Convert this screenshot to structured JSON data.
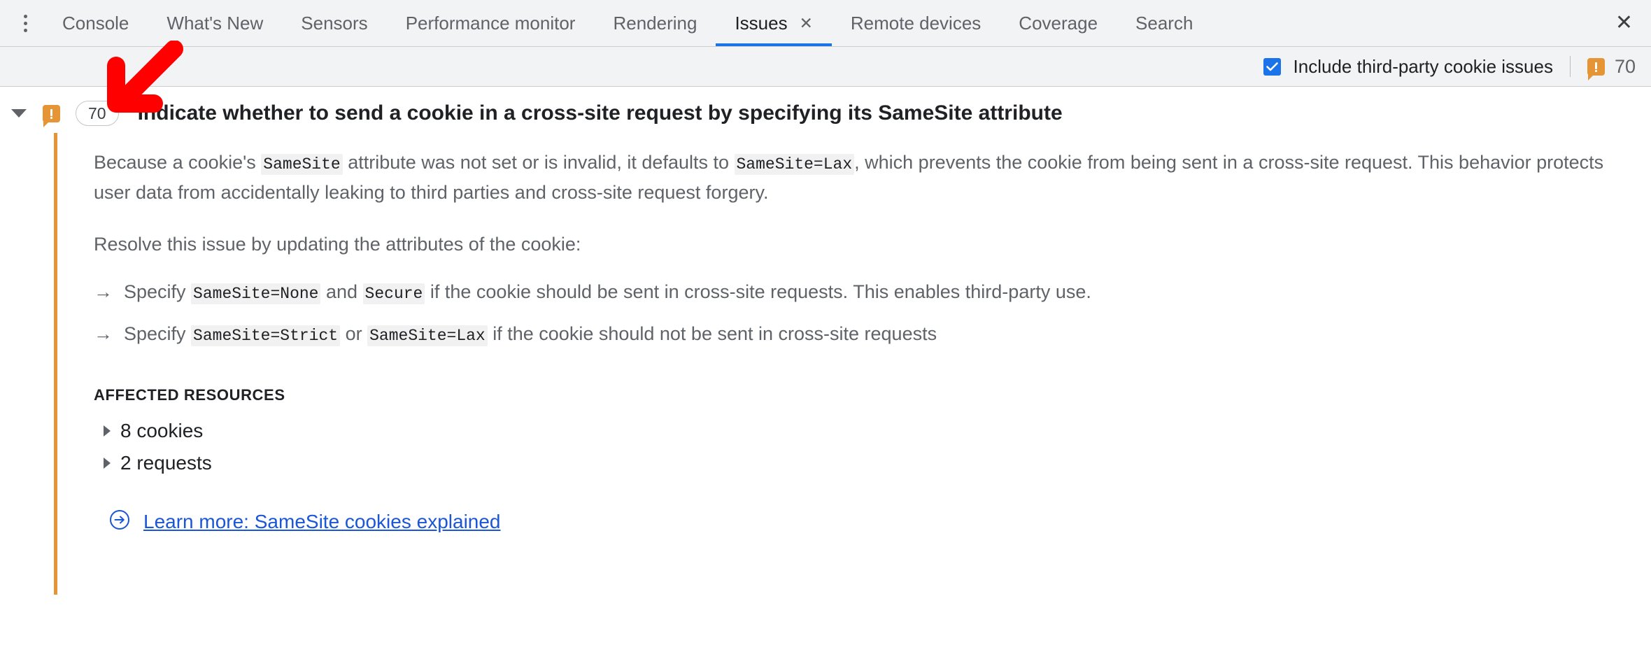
{
  "tabstrip": {
    "menu_icon": "more-vertical-icon",
    "close_icon": "close-icon",
    "tabs": [
      {
        "label": "Console",
        "active": false,
        "closable": false
      },
      {
        "label": "What's New",
        "active": false,
        "closable": false
      },
      {
        "label": "Sensors",
        "active": false,
        "closable": false
      },
      {
        "label": "Performance monitor",
        "active": false,
        "closable": false
      },
      {
        "label": "Rendering",
        "active": false,
        "closable": false
      },
      {
        "label": "Issues",
        "active": true,
        "closable": true
      },
      {
        "label": "Remote devices",
        "active": false,
        "closable": false
      },
      {
        "label": "Coverage",
        "active": false,
        "closable": false
      },
      {
        "label": "Search",
        "active": false,
        "closable": false
      }
    ],
    "tab_close_glyph": "✕",
    "close_glyph": "✕",
    "active_underline_color": "#1a73e8"
  },
  "toolbar": {
    "checkbox_label": "Include third-party cookie issues",
    "checkbox_checked": true,
    "checkbox_color": "#1a73e8",
    "warning_count": "70",
    "warning_icon": "warning-icon",
    "warning_color": "#e59536"
  },
  "issue": {
    "expanded": true,
    "warning_icon": "warning-icon",
    "count_badge": "70",
    "title": "Indicate whether to send a cookie in a cross-site request by specifying its SameSite attribute",
    "accent_color": "#e59536",
    "paragraph1": {
      "p1": "Because a cookie's ",
      "c1": "SameSite",
      "p2": " attribute was not set or is invalid, it defaults to ",
      "c2": "SameSite=Lax",
      "p3": ", which prevents the cookie from being sent in a cross-site request. This behavior protects user data from accidentally leaking to third parties and cross-site request forgery."
    },
    "paragraph2": "Resolve this issue by updating the attributes of the cookie:",
    "bullets": [
      {
        "arrow": "→",
        "p1": "Specify ",
        "c1": "SameSite=None",
        "p2": " and ",
        "c2": "Secure",
        "p3": " if the cookie should be sent in cross-site requests. This enables third-party use."
      },
      {
        "arrow": "→",
        "p1": "Specify ",
        "c1": "SameSite=Strict",
        "p2": " or ",
        "c2": "SameSite=Lax",
        "p3": " if the cookie should not be sent in cross-site requests"
      }
    ],
    "affected_resources_title": "AFFECTED RESOURCES",
    "resources": [
      {
        "label": "8 cookies"
      },
      {
        "label": "2 requests"
      }
    ],
    "learn_more": {
      "icon": "arrow-circle-right-icon",
      "label": "Learn more: SameSite cookies explained",
      "color": "#1a56d6"
    }
  },
  "annotation": {
    "arrow_color": "#ff0000",
    "icon": "down-left-arrow-annotation"
  }
}
